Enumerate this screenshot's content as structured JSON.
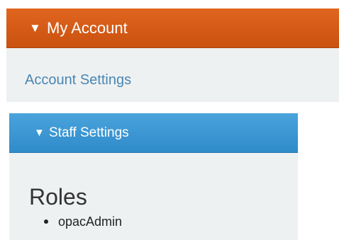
{
  "account_panel": {
    "arrow": "▼",
    "title": "My Account",
    "link_label": "Account Settings"
  },
  "staff_panel": {
    "arrow": "▼",
    "title": "Staff Settings",
    "roles_heading": "Roles",
    "roles": [
      "opacAdmin"
    ]
  },
  "colors": {
    "account_header": "#d55a16",
    "staff_header": "#3d98d4",
    "panel_body": "#eef1f2",
    "link": "#4a86b2"
  }
}
